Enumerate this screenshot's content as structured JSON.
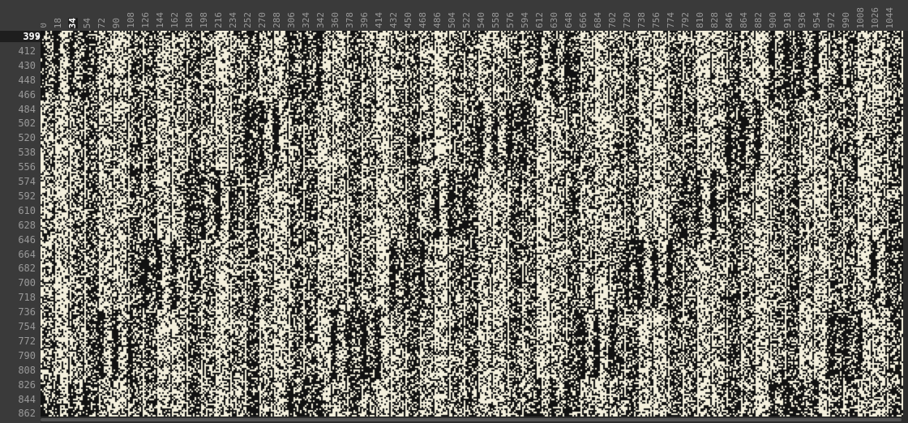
{
  "viewer": {
    "selected_column": "34",
    "selected_row": "399",
    "cursor_icon": "row-marker-icon",
    "column_labels": [
      "0",
      "18",
      "34",
      "54",
      "72",
      "90",
      "108",
      "126",
      "144",
      "162",
      "180",
      "198",
      "216",
      "234",
      "252",
      "270",
      "288",
      "306",
      "324",
      "342",
      "360",
      "378",
      "396",
      "414",
      "432",
      "450",
      "468",
      "486",
      "504",
      "522",
      "540",
      "558",
      "576",
      "594",
      "612",
      "630",
      "648",
      "666",
      "684",
      "702",
      "720",
      "738",
      "756",
      "774",
      "792",
      "810",
      "828",
      "846",
      "864",
      "882",
      "900",
      "918",
      "936",
      "954",
      "972",
      "990",
      "1008",
      "1026",
      "1044"
    ],
    "row_labels": [
      "399",
      "412",
      "430",
      "448",
      "466",
      "484",
      "502",
      "520",
      "538",
      "556",
      "574",
      "592",
      "610",
      "628",
      "646",
      "664",
      "682",
      "700",
      "718",
      "736",
      "754",
      "772",
      "790",
      "808",
      "826",
      "844",
      "862"
    ],
    "colors": {
      "background": "#3a3a3a",
      "pixel_light": "#f3efdc",
      "pixel_dark": "#121212",
      "label": "#9a9a9a",
      "label_active": "#ffffff"
    }
  }
}
